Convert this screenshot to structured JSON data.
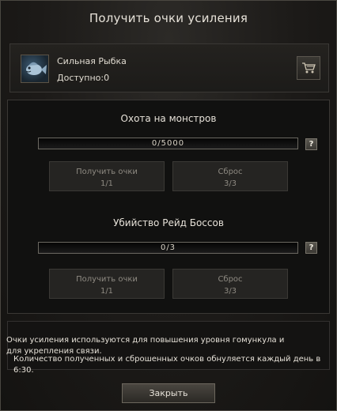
{
  "dialog": {
    "title": "Получить очки усиления",
    "item": {
      "name": "Сильная Рыбка",
      "available_label": "Доступно:",
      "available_value": "0",
      "icon": "fish-icon"
    },
    "shop_icon": "cart-icon",
    "sections": [
      {
        "title": "Охота на монстров",
        "progress_text": "0/5000",
        "progress_fraction": 0,
        "help_label": "?",
        "get_button": {
          "label": "Получить очки",
          "count": "1/1"
        },
        "reset_button": {
          "label": "Сброс",
          "count": "3/3"
        }
      },
      {
        "title": "Убийство Рейд Боссов",
        "progress_text": "0/3",
        "progress_fraction": 0,
        "help_label": "?",
        "get_button": {
          "label": "Получить очки",
          "count": "1/1"
        },
        "reset_button": {
          "label": "Сброс",
          "count": "3/3"
        }
      }
    ],
    "info": {
      "line1": "Очки усиления используются для повышения уровня гомункула и для укрепления связи.",
      "line2": "Количество полученных и сброшенных очков обнуляется каждый день в 6:30."
    },
    "close_label": "Закрыть"
  }
}
